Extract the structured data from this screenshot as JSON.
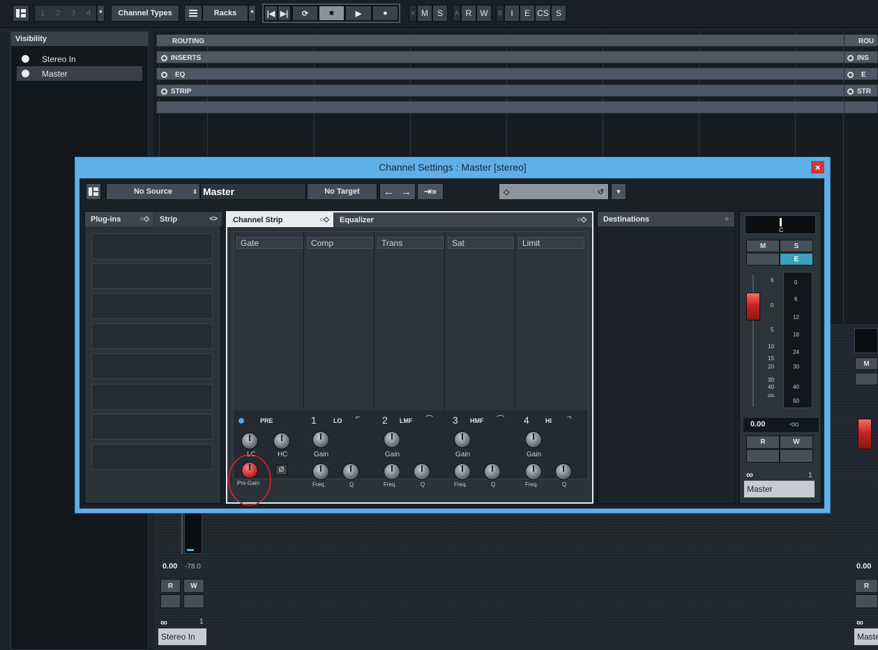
{
  "toolbar": {
    "pages": [
      "1",
      "2",
      "3",
      "4"
    ],
    "star": "*",
    "channel_types": "Channel Types",
    "racks": "Racks",
    "rec_x": "X",
    "rec_m": "M",
    "rec_s": "S",
    "auto_a": "A",
    "auto_r": "R",
    "auto_w": "W",
    "b": "B",
    "i": "I",
    "e": "E",
    "cs": "CS",
    "s2": "S"
  },
  "visibility": {
    "title": "Visibility",
    "items": [
      {
        "label": "Stereo In"
      },
      {
        "label": "Master"
      }
    ]
  },
  "rack_bars": {
    "routing": "ROUTING",
    "inserts": "INSERTS",
    "eq": "EQ",
    "strip": "STRIP",
    "right_routing": "ROU",
    "right_inserts": "INS",
    "right_eq": "E",
    "right_strip": "STR"
  },
  "bg_channel_left": {
    "volume": "0.00",
    "peak": "-78.0",
    "r": "R",
    "w": "W",
    "link": "1",
    "name": "Stereo In"
  },
  "bg_channel_right": {
    "volume": "0.00",
    "m": "M",
    "r": "R",
    "name": "Maste"
  },
  "dialog": {
    "title": "Channel Settings : Master [stereo]",
    "close": "×",
    "no_source": "No Source",
    "channel_name": "Master",
    "no_target": "No Target",
    "panes": {
      "plugins": "Plug-ins",
      "strip": "Strip",
      "channel_strip": "Channel Strip",
      "equalizer": "Equalizer",
      "destinations": "Destinations"
    },
    "modules": [
      "Gate",
      "Comp",
      "Trans",
      "Sat",
      "Limit"
    ],
    "pre": {
      "label": "PRE",
      "lc": "LC",
      "hc": "HC",
      "pre_gain": "Pre-Gain",
      "phase": "Ø"
    },
    "bands": [
      {
        "num": "1",
        "name": "LO",
        "gain": "Gain",
        "freq": "Freq.",
        "q": "Q"
      },
      {
        "num": "2",
        "name": "LMF",
        "gain": "Gain",
        "freq": "Freq.",
        "q": "Q"
      },
      {
        "num": "3",
        "name": "HMF",
        "gain": "Gain",
        "freq": "Freq.",
        "q": "Q"
      },
      {
        "num": "4",
        "name": "HI",
        "gain": "Gain",
        "freq": "Freq.",
        "q": "Q"
      }
    ],
    "channel": {
      "pan": "C",
      "m": "M",
      "s": "S",
      "e": "E",
      "r": "R",
      "w": "W",
      "volume": "0.00",
      "peak": "-oo",
      "link_num": "1",
      "name": "Master",
      "fader_scale": [
        "6",
        "0",
        "5",
        "10",
        "15",
        "20",
        "30",
        "40",
        "oo"
      ],
      "meter_scale": [
        "0",
        "6",
        "12",
        "18",
        "24",
        "30",
        "40",
        "50"
      ]
    }
  }
}
